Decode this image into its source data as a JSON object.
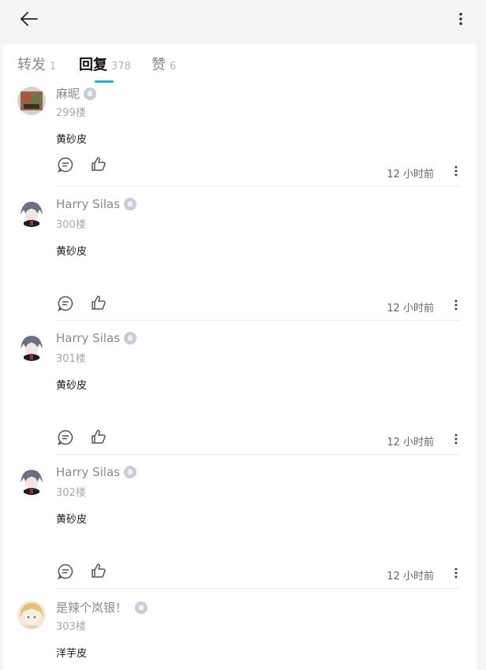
{
  "header": {
    "back_icon": "arrow-left-icon",
    "more_icon": "more-vertical-icon"
  },
  "tabs": [
    {
      "label": "转发",
      "count": "1",
      "active": false
    },
    {
      "label": "回复",
      "count": "378",
      "active": true
    },
    {
      "label": "赞",
      "count": "6",
      "active": false
    }
  ],
  "accent_color": "#1fb3c9",
  "comments": [
    {
      "username": "麻昵",
      "floor": "299楼",
      "text": "黄砂皮",
      "time": "12 小时前",
      "avatar": "avatar-thumbnail"
    },
    {
      "username": "Harry Silas",
      "floor": "300楼",
      "text": "黄砂皮",
      "time": "12 小时前",
      "avatar": "avatar-anime-character"
    },
    {
      "username": "Harry Silas",
      "floor": "301楼",
      "text": "黄砂皮",
      "time": "12 小时前",
      "avatar": "avatar-anime-character"
    },
    {
      "username": "Harry Silas",
      "floor": "302楼",
      "text": "黄砂皮",
      "time": "12 小时前",
      "avatar": "avatar-anime-character"
    },
    {
      "username": "是辣个岚银！",
      "floor": "303楼",
      "text": "洋芋皮",
      "time": "",
      "avatar": "avatar-anime-blonde"
    }
  ]
}
